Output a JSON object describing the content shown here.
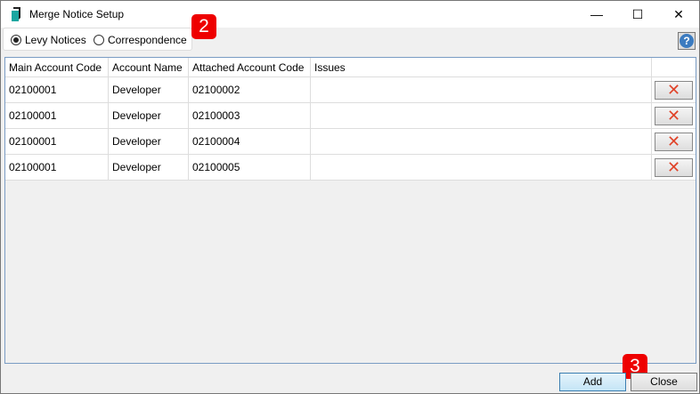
{
  "window": {
    "title": "Merge Notice Setup",
    "minimize": "—",
    "maximize": "☐",
    "close": "✕"
  },
  "radios": [
    {
      "label": "Levy Notices",
      "checked": true
    },
    {
      "label": "Correspondence",
      "checked": false
    }
  ],
  "badges": [
    "2",
    "3"
  ],
  "help_icon": "?",
  "table": {
    "columns": [
      "Main Account Code",
      "Account Name",
      "Attached Account Code",
      "Issues",
      ""
    ],
    "rows": [
      {
        "main": "02100001",
        "name": "Developer",
        "attached": "02100002",
        "issues": ""
      },
      {
        "main": "02100001",
        "name": "Developer",
        "attached": "02100003",
        "issues": ""
      },
      {
        "main": "02100001",
        "name": "Developer",
        "attached": "02100004",
        "issues": ""
      },
      {
        "main": "02100001",
        "name": "Developer",
        "attached": "02100005",
        "issues": ""
      }
    ]
  },
  "delete_glyph": "✕",
  "buttons": {
    "add": "Add",
    "close": "Close"
  }
}
